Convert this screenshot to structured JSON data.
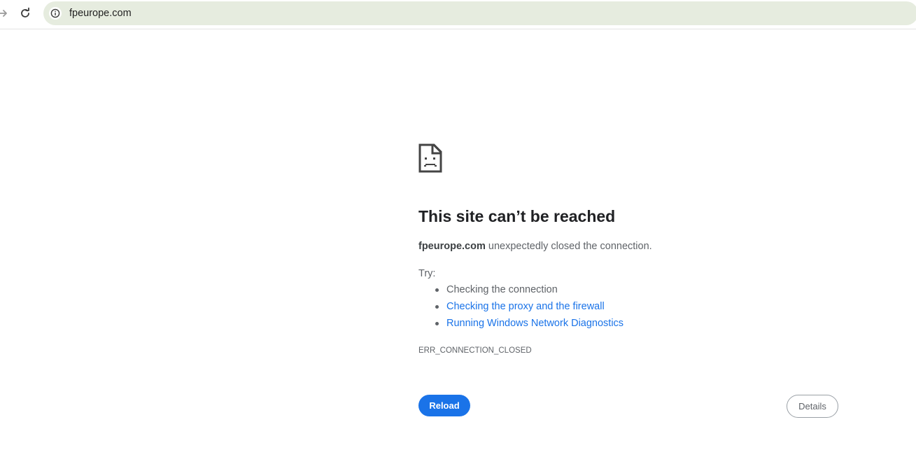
{
  "browser": {
    "url": "fpeurope.com",
    "icons": {
      "forward": "arrow-forward-icon",
      "reload": "reload-icon",
      "site_info": "info-icon"
    },
    "omnibox_color": "#e6ecdf"
  },
  "error_page": {
    "icon": "sad-document-icon",
    "title": "This site can’t be reached",
    "host": "fpeurope.com",
    "message": " unexpectedly closed the connection.",
    "try_label": "Try:",
    "suggestions": [
      {
        "label": "Checking the connection",
        "is_link": false
      },
      {
        "label": "Checking the proxy and the firewall",
        "is_link": true
      },
      {
        "label": "Running Windows Network Diagnostics",
        "is_link": true
      }
    ],
    "error_code": "ERR_CONNECTION_CLOSED",
    "reload_label": "Reload",
    "details_label": "Details",
    "accent_color": "#1a73e8"
  }
}
